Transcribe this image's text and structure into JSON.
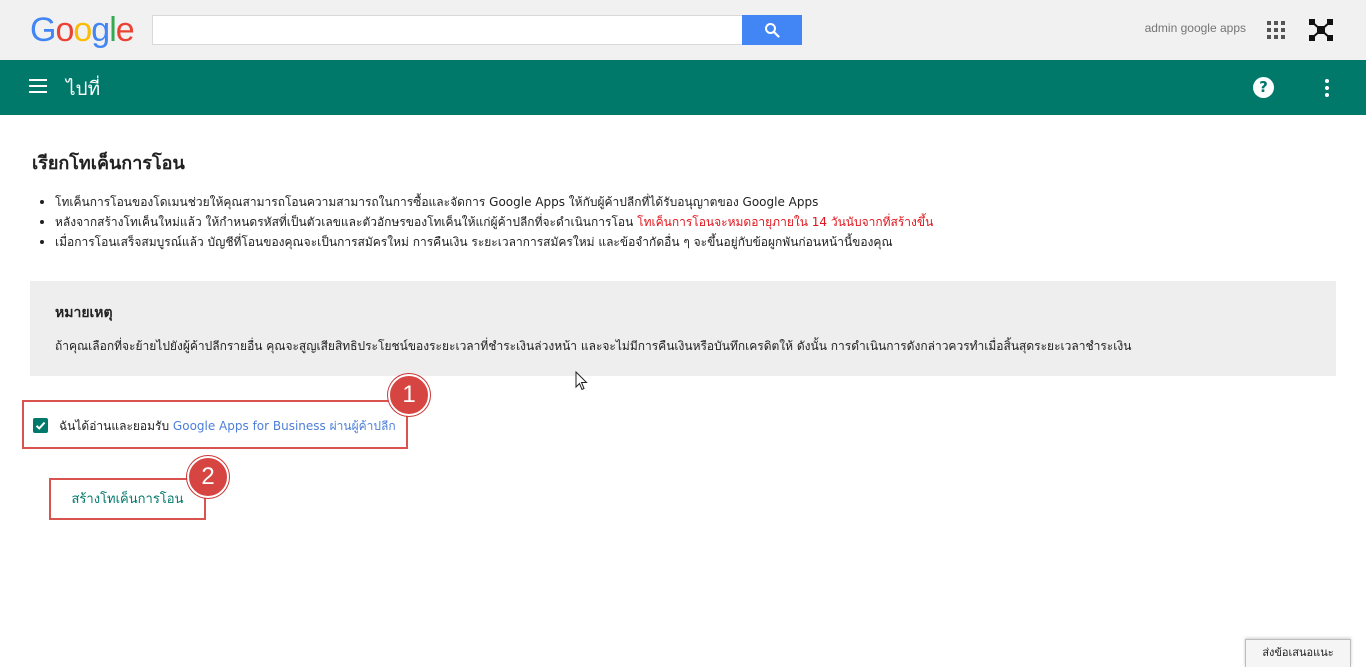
{
  "header": {
    "logo_letters": [
      {
        "char": "G",
        "color": "#4285f4"
      },
      {
        "char": "o",
        "color": "#ea4335"
      },
      {
        "char": "o",
        "color": "#fbbc05"
      },
      {
        "char": "g",
        "color": "#4285f4"
      },
      {
        "char": "l",
        "color": "#34a853"
      },
      {
        "char": "e",
        "color": "#ea4335"
      }
    ],
    "search_value": "",
    "account_name": "admin google apps"
  },
  "navbar": {
    "title": "ไปที่",
    "color": "#00796b"
  },
  "main": {
    "title": "เรียกโทเค็นการโอน",
    "bullets": [
      {
        "text": "โทเค็นการโอนของโดเมนช่วยให้คุณสามารถโอนความสามารถในการซื้อและจัดการ Google Apps ให้กับผู้ค้าปลีกที่ได้รับอนุญาตของ Google Apps",
        "warning": ""
      },
      {
        "text": "หลังจากสร้างโทเค็นใหม่แล้ว ให้กำหนดรหัสที่เป็นตัวเลขและตัวอักษรของโทเค็นให้แก่ผู้ค้าปลีกที่จะดำเนินการโอน ",
        "warning": "โทเค็นการโอนจะหมดอายุภายใน 14 วันนับจากที่สร้างขึ้น"
      },
      {
        "text": "เมื่อการโอนเสร็จสมบูรณ์แล้ว บัญชีที่โอนของคุณจะเป็นการสมัครใหม่ การคืนเงิน ระยะเวลาการสมัครใหม่ และข้อจำกัดอื่น ๆ จะขึ้นอยู่กับข้อผูกพันก่อนหน้านี้ของคุณ",
        "warning": ""
      }
    ],
    "note": {
      "title": "หมายเหตุ",
      "text": "ถ้าคุณเลือกที่จะย้ายไปยังผู้ค้าปลีกรายอื่น คุณจะสูญเสียสิทธิประโยชน์ของระยะเวลาที่ชำระเงินล่วงหน้า และจะไม่มีการคืนเงินหรือบันทึกเครดิตให้ ดังนั้น การดำเนินการดังกล่าวควรทำเมื่อสิ้นสุดระยะเวลาชำระเงิน"
    },
    "agree": {
      "checked": true,
      "prefix": "ฉันได้อ่านและยอมรับ ",
      "link": "Google Apps for Business ผ่านผู้ค้าปลีก"
    },
    "create_button": "สร้างโทเค็นการโอน",
    "step_badges": [
      "1",
      "2"
    ]
  },
  "footer": {
    "feedback_button": "ส่งข้อเสนอแนะ"
  }
}
